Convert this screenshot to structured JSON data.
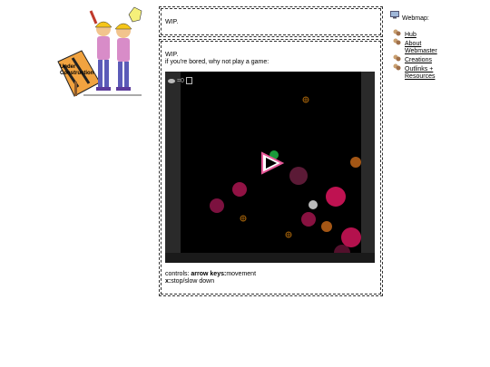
{
  "top_box": {
    "text": "WIP."
  },
  "main_box": {
    "wip": "WIP.",
    "bored": "if you're bored, why not play a game:",
    "controls_prefix": "controls: ",
    "controls_arrow_bold": "arrow keys:",
    "controls_arrow_rest": "movement",
    "controls_x_bold": "x:",
    "controls_x_rest": "stop/slow down"
  },
  "game": {
    "hud_text": "=0"
  },
  "sign": {
    "text_line1": "Under",
    "text_line2": "Construction"
  },
  "webmap": {
    "title": "Webmap:",
    "items": [
      {
        "label": "Hub"
      },
      {
        "label": "About"
      },
      {
        "label": "Webmaster"
      },
      {
        "label": "Creations"
      },
      {
        "label": "Outlinks +"
      },
      {
        "label": "Resources"
      }
    ]
  },
  "colors": {
    "game_bg": "#000000",
    "frame": "#2a2a2a",
    "blob_pink": "#d4145a",
    "blob_dark": "#7a2040",
    "orange": "#e87a1e"
  }
}
